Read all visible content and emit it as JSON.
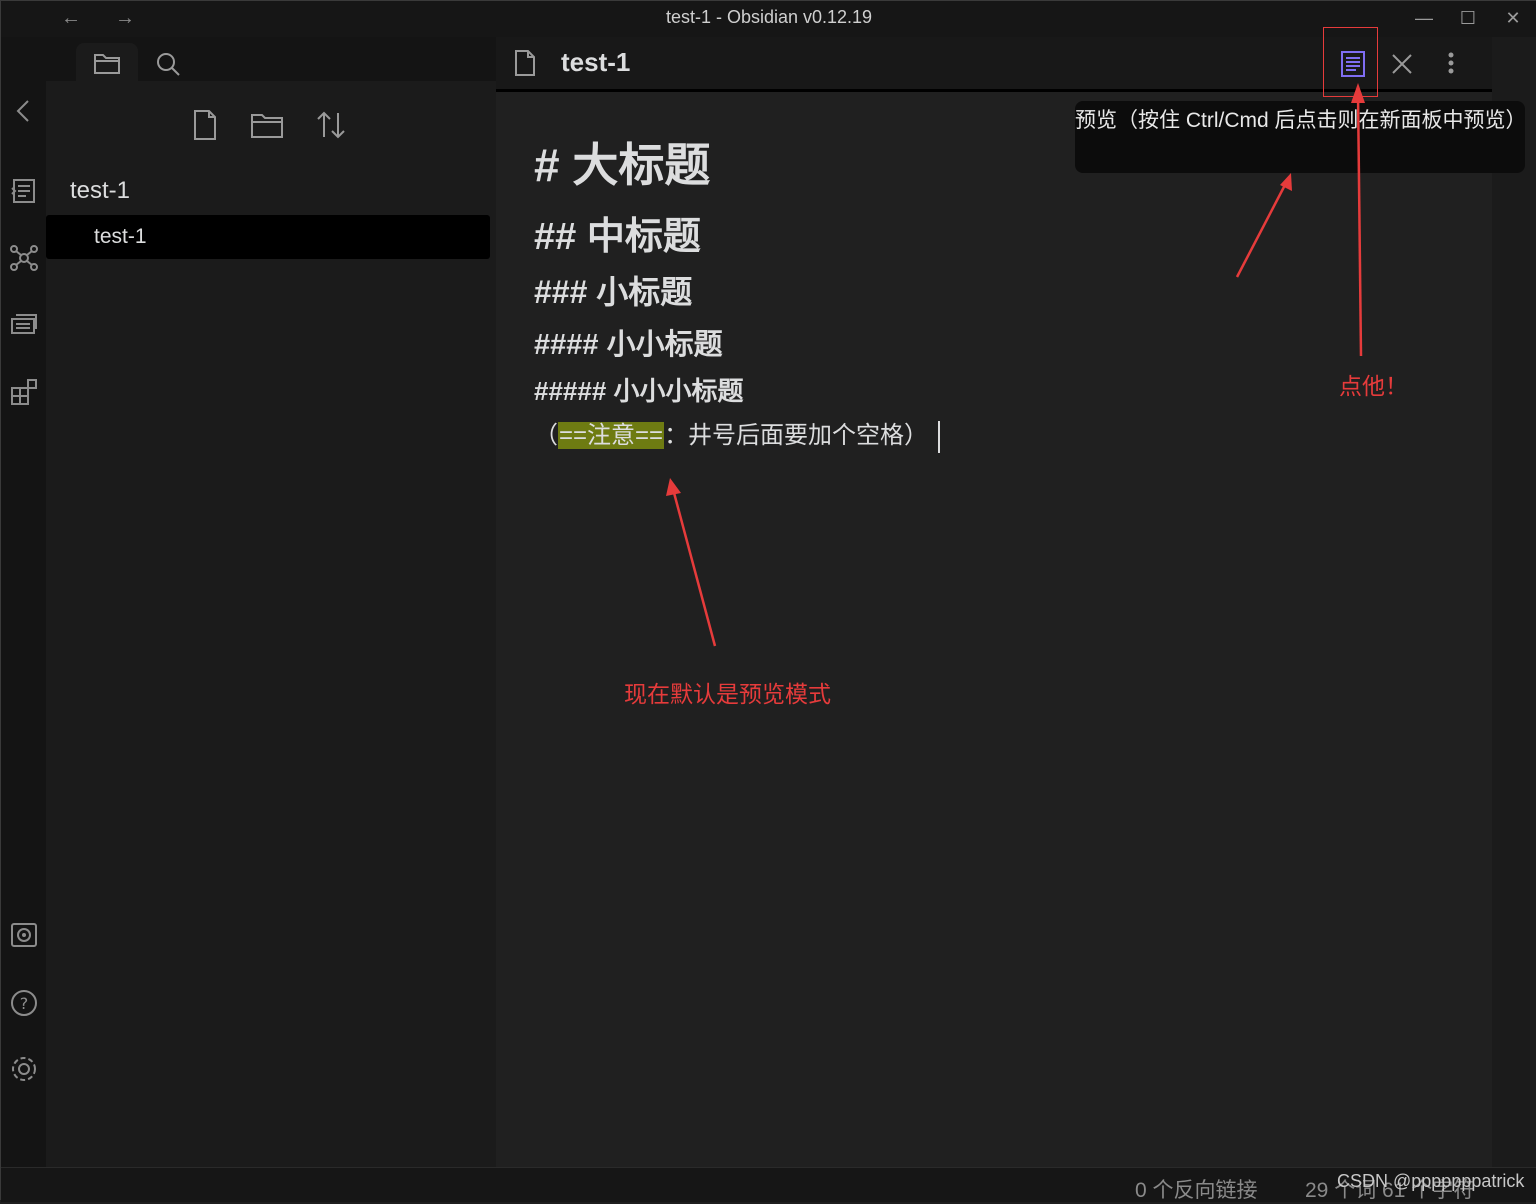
{
  "window": {
    "title": "test-1 - Obsidian v0.12.19",
    "back_icon": "arrow-left-icon",
    "forward_icon": "arrow-right-icon"
  },
  "sidebar": {
    "tabs": [
      "file-explorer",
      "search"
    ],
    "toolbar": [
      "new-note",
      "new-folder",
      "sort"
    ],
    "folder_name": "test-1",
    "files": [
      {
        "label": "test-1",
        "active": true
      }
    ]
  },
  "ribbon": {
    "top_icons": [
      "collapse-icon",
      "command-palette-icon",
      "graph-icon",
      "slides-icon",
      "plugins-icon"
    ],
    "bottom_icons": [
      "vault-icon",
      "help-icon",
      "settings-icon"
    ]
  },
  "pane": {
    "title": "test-1",
    "tooltip": "预览（按住 Ctrl/Cmd 后点击则在新面板中预览）"
  },
  "editor": {
    "h1": "# 大标题",
    "h2": "## 中标题",
    "h3": "### 小标题",
    "h4": "#### 小小标题",
    "h5": "##### 小小小标题",
    "note_prefix": "（",
    "note_highlight": "==注意==",
    "note_suffix": "：井号后面要加个空格）"
  },
  "annotations": {
    "click_it": "点他！",
    "default_mode": "现在默认是预览模式"
  },
  "statusbar": {
    "backlinks": "0 个反向链接",
    "counts": "29 个词 61 个字符"
  },
  "watermark": "CSDN @pppppppatrick",
  "colors": {
    "accent": "#7f6df2",
    "annotation": "#e63b3b",
    "highlight": "#6e7b12"
  }
}
